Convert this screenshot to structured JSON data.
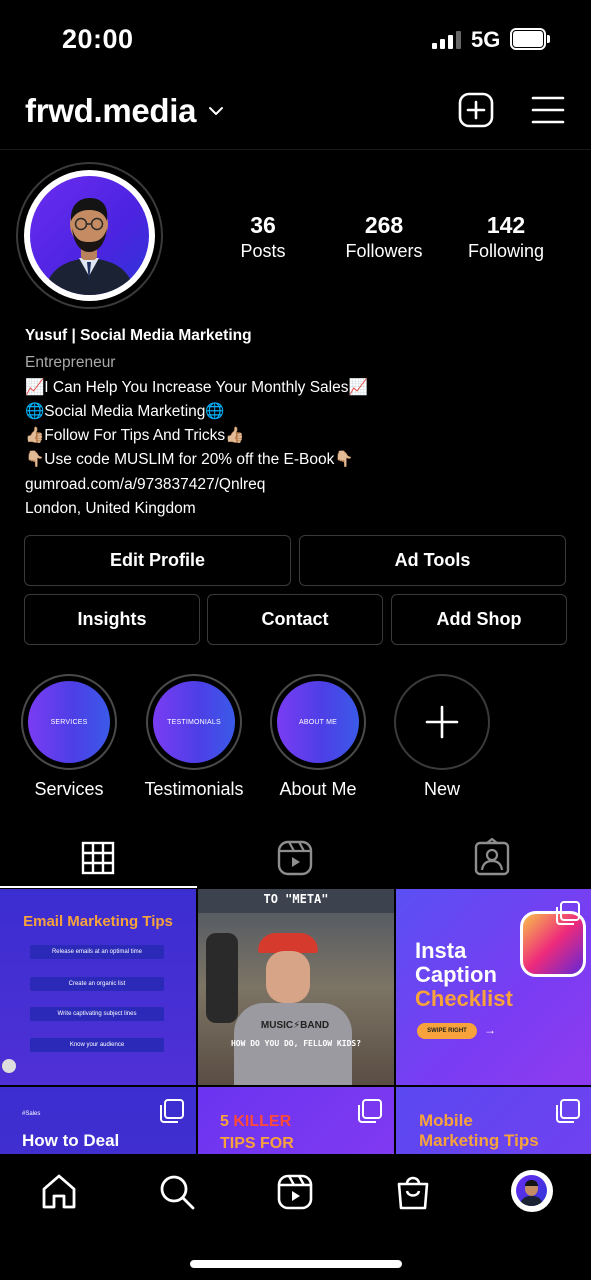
{
  "status_bar": {
    "time": "20:00",
    "network": "5G"
  },
  "header": {
    "username": "frwd.media",
    "icons": [
      "chevron-down-icon",
      "add-post-icon",
      "menu-icon"
    ]
  },
  "profile": {
    "stats": [
      {
        "value": "36",
        "label": "Posts"
      },
      {
        "value": "268",
        "label": "Followers"
      },
      {
        "value": "142",
        "label": "Following"
      }
    ],
    "name": "Yusuf | Social Media Marketing",
    "category": "Entrepreneur",
    "bio_lines": [
      "📈I Can Help You Increase Your Monthly Sales📈",
      "🌐Social Media Marketing🌐",
      "👍🏼Follow For Tips And Tricks👍🏼",
      "👇🏼Use code MUSLIM for 20% off the E-Book👇🏼"
    ],
    "link": "gumroad.com/a/973837427/Qnlreq",
    "location": "London, United Kingdom"
  },
  "buttons": {
    "edit_profile": "Edit Profile",
    "ad_tools": "Ad Tools",
    "insights": "Insights",
    "contact": "Contact",
    "add_shop": "Add Shop"
  },
  "highlights": [
    {
      "label": "Services",
      "cover_text": "SERVICES"
    },
    {
      "label": "Testimonials",
      "cover_text": "TESTIMONIALS"
    },
    {
      "label": "About Me",
      "cover_text": "ABOUT ME"
    },
    {
      "label": "New",
      "cover_text": ""
    }
  ],
  "tabs": [
    "grid-icon",
    "reels-icon",
    "tagged-icon"
  ],
  "posts": [
    {
      "title": "Email Marketing Tips",
      "items": [
        "Release emails at an optimal time",
        "Create an organic list",
        "Write captivating subject lines",
        "Know your audience"
      ]
    },
    {
      "top": "TO \"META\"",
      "shirt": "MUSIC⚡BAND",
      "caption": "HOW DO YOU DO, FELLOW KIDS?"
    },
    {
      "title_1": "Insta",
      "title_2": "Caption",
      "title_3": "Checklist",
      "cta": "SWIPE RIGHT",
      "arrow": "→"
    },
    {
      "tag": "#Sales",
      "title": "How to Deal"
    },
    {
      "title_1": "5",
      "title_2": "KILLER",
      "title_3": "TIPS FOR"
    },
    {
      "title_1": "Mobile",
      "title_2": "Marketing Tips"
    }
  ],
  "nav": [
    "home-icon",
    "search-icon",
    "reels-icon",
    "shop-icon",
    "profile-avatar"
  ],
  "colors": {
    "accent": "#7a3cf2",
    "blue": "#3b2ed0",
    "orange": "#f7a23a",
    "background": "#000000"
  }
}
